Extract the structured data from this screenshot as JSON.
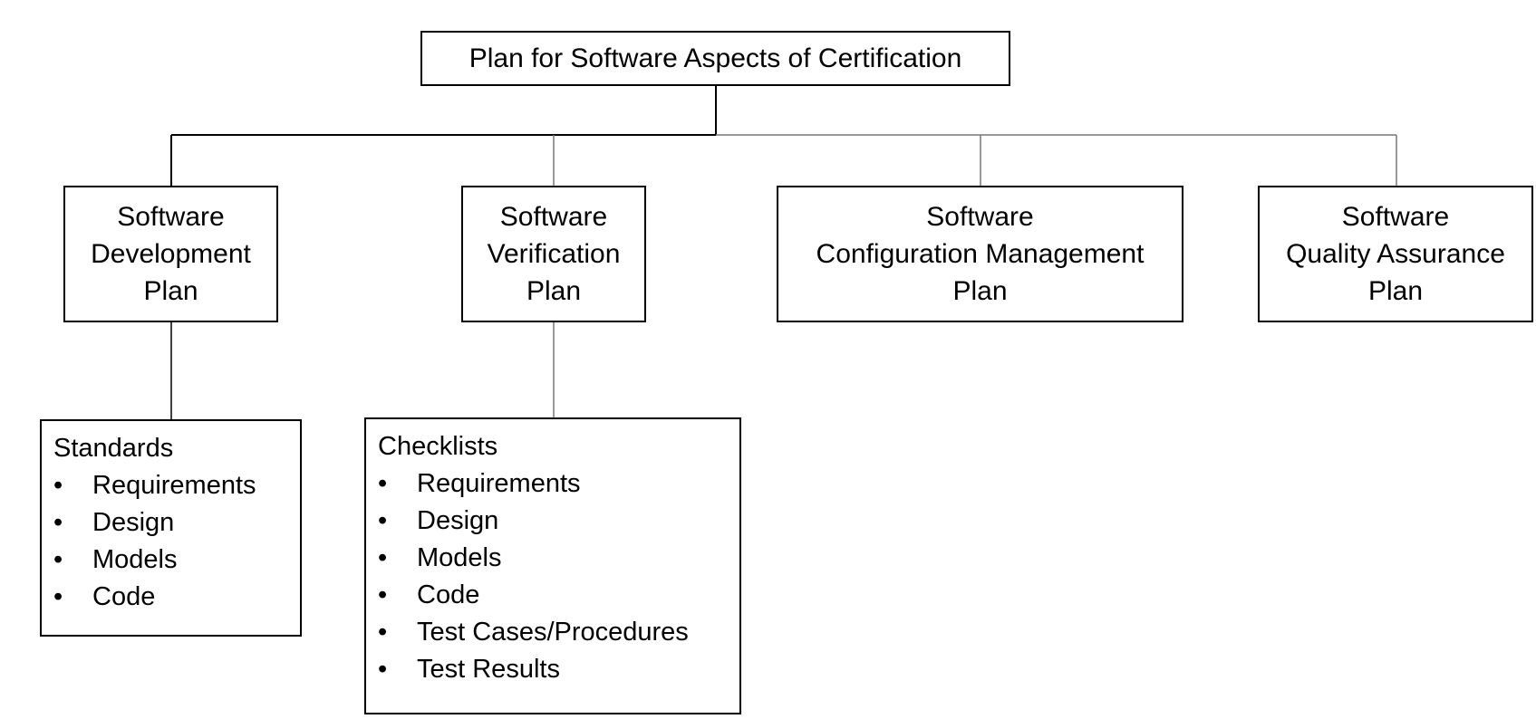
{
  "root": {
    "label": "Plan for Software Aspects of Certification"
  },
  "plans": [
    {
      "lines": [
        "Software",
        "Development",
        "Plan"
      ]
    },
    {
      "lines": [
        "Software",
        "Verification",
        "Plan"
      ]
    },
    {
      "lines": [
        "Software",
        "Configuration Management",
        "Plan"
      ]
    },
    {
      "lines": [
        "Software",
        "Quality Assurance",
        "Plan"
      ]
    }
  ],
  "standards": {
    "heading": "Standards",
    "bullet": "•",
    "items": [
      "Requirements",
      "Design",
      "Models",
      "Code"
    ]
  },
  "checklists": {
    "heading": "Checklists",
    "bullet": "•",
    "items": [
      "Requirements",
      "Design",
      "Models",
      "Code",
      "Test Cases/Procedures",
      "Test Results"
    ]
  }
}
